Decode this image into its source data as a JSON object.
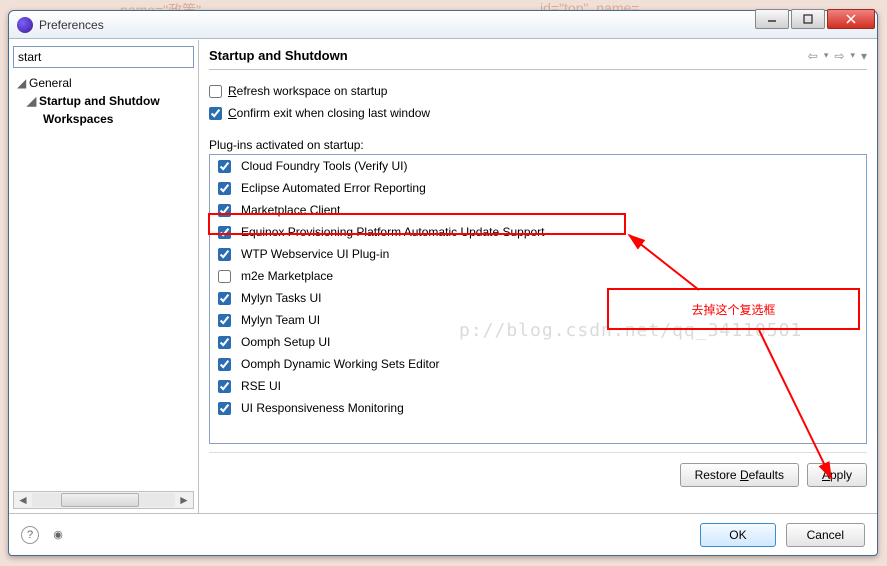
{
  "window": {
    "title": "Preferences"
  },
  "sidebar": {
    "search_value": "start",
    "tree": {
      "general": "General",
      "startup": "Startup and Shutdow",
      "workspaces": "Workspaces"
    }
  },
  "main": {
    "title": "Startup and Shutdown",
    "refresh_label_pre": "R",
    "refresh_label_rest": "efresh workspace on startup",
    "confirm_label_pre": "C",
    "confirm_label_rest": "onfirm exit when closing last window",
    "plugins_label": "Plug-ins activated on startup:",
    "plugins": [
      {
        "label": "Cloud Foundry Tools (Verify UI)",
        "checked": true
      },
      {
        "label": "Eclipse Automated Error Reporting",
        "checked": true
      },
      {
        "label": "Marketplace Client",
        "checked": true
      },
      {
        "label": "Equinox Provisioning Platform Automatic Update Support",
        "checked": true
      },
      {
        "label": "WTP Webservice UI Plug-in",
        "checked": true
      },
      {
        "label": "m2e Marketplace",
        "checked": false
      },
      {
        "label": "Mylyn Tasks UI",
        "checked": true
      },
      {
        "label": "Mylyn Team UI",
        "checked": true
      },
      {
        "label": "Oomph Setup UI",
        "checked": true
      },
      {
        "label": "Oomph Dynamic Working Sets Editor",
        "checked": true
      },
      {
        "label": "RSE UI",
        "checked": true
      },
      {
        "label": "UI Responsiveness Monitoring",
        "checked": true
      }
    ],
    "restore_label": "Restore Defaults",
    "apply_label": "Apply"
  },
  "footer": {
    "ok_label": "OK",
    "cancel_label": "Cancel"
  },
  "annotation": {
    "text": "去掉这个复选框"
  },
  "watermark": "p://blog.csdn.net/qq_34110501"
}
